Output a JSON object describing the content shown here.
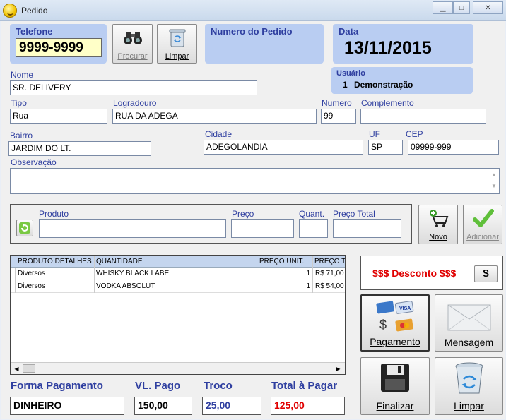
{
  "window": {
    "title": "Pedido"
  },
  "telefone": {
    "label": "Telefone",
    "value": "9999-9999"
  },
  "toolbar": {
    "procurar_label": "Procurar",
    "limpar_label": "Limpar"
  },
  "pedido": {
    "label": "Numero do Pedido"
  },
  "data": {
    "label": "Data",
    "value": "13/11/2015"
  },
  "usuario": {
    "label": "Usuário",
    "id": "1",
    "name": "Demonstração"
  },
  "nome": {
    "label": "Nome",
    "value": "SR. DELIVERY"
  },
  "tipo": {
    "label": "Tipo",
    "value": "Rua"
  },
  "logradouro": {
    "label": "Logradouro",
    "value": "RUA DA ADEGA"
  },
  "numero": {
    "label": "Numero",
    "value": "99"
  },
  "complemento": {
    "label": "Complemento",
    "value": ""
  },
  "bairro": {
    "label": "Bairro",
    "value": "JARDIM DO LT."
  },
  "cidade": {
    "label": "Cidade",
    "value": "ADEGOLANDIA"
  },
  "uf": {
    "label": "UF",
    "value": "SP"
  },
  "cep": {
    "label": "CEP",
    "value": "09999-999"
  },
  "observacao": {
    "label": "Observação",
    "value": ""
  },
  "produto": {
    "label": "Produto",
    "preco_label": "Preço",
    "quant_label": "Quant.",
    "preco_total_label": "Preço Total"
  },
  "novo_label": "Novo",
  "adicionar_label": "Adicionar",
  "grid": {
    "headers": [
      "PRODUTO DETALHES",
      "QUANTIDADE",
      "PREÇO UNIT.",
      "PREÇO T"
    ],
    "rows": [
      {
        "detalhes": "Diversos",
        "quantidade": "WHISKY BLACK LABEL",
        "preco_unit": "1",
        "preco_total": "R$ 71,00"
      },
      {
        "detalhes": "Diversos",
        "quantidade": "VODKA ABSOLUT",
        "preco_unit": "1",
        "preco_total": "R$ 54,00"
      }
    ]
  },
  "desconto": {
    "label": "$$$ Desconto $$$",
    "button": "$"
  },
  "pagamento_label": "Pagamento",
  "mensagem_label": "Mensagem",
  "finalizar_label": "Finalizar",
  "limpar2_label": "Limpar",
  "totais": {
    "forma_label": "Forma Pagamento",
    "forma_value": "DINHEIRO",
    "pago_label": "VL. Pago",
    "pago_value": "150,00",
    "troco_label": "Troco",
    "troco_value": "25,00",
    "total_label": "Total à Pagar",
    "total_value": "125,00"
  },
  "colors": {
    "accent": "#2f3fa0",
    "panel": "#b9cdf2",
    "red": "#e00000"
  }
}
